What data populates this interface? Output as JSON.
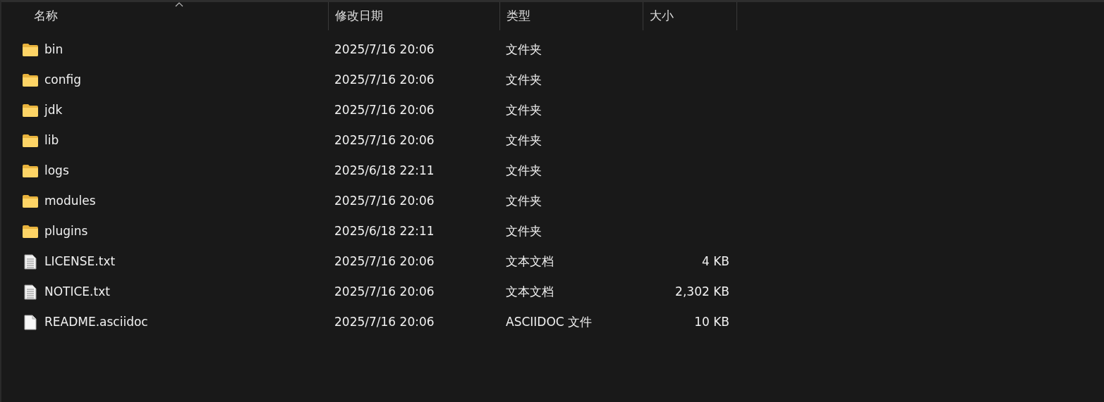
{
  "columns": [
    {
      "label": "名称",
      "sorted": true
    },
    {
      "label": "修改日期",
      "sorted": false
    },
    {
      "label": "类型",
      "sorted": false
    },
    {
      "label": "大小",
      "sorted": false
    }
  ],
  "rows": [
    {
      "kind": "folder",
      "name": "bin",
      "date": "2025/7/16 20:06",
      "type": "文件夹"
    },
    {
      "kind": "folder",
      "name": "config",
      "date": "2025/7/16 20:06",
      "type": "文件夹"
    },
    {
      "kind": "folder",
      "name": "jdk",
      "date": "2025/7/16 20:06",
      "type": "文件夹"
    },
    {
      "kind": "folder",
      "name": "lib",
      "date": "2025/7/16 20:06",
      "type": "文件夹"
    },
    {
      "kind": "folder",
      "name": "logs",
      "date": "2025/6/18 22:11",
      "type": "文件夹"
    },
    {
      "kind": "folder",
      "name": "modules",
      "date": "2025/7/16 20:06",
      "type": "文件夹"
    },
    {
      "kind": "folder",
      "name": "plugins",
      "date": "2025/6/18 22:11",
      "type": "文件夹"
    },
    {
      "kind": "text",
      "name": "LICENSE.txt",
      "date": "2025/7/16 20:06",
      "type": "文本文档",
      "size": "4 KB"
    },
    {
      "kind": "text",
      "name": "NOTICE.txt",
      "date": "2025/7/16 20:06",
      "type": "文本文档",
      "size": "2,302 KB"
    },
    {
      "kind": "file",
      "name": "README.asciidoc",
      "date": "2025/7/16 20:06",
      "type": "ASCIIDOC 文件",
      "size": "10 KB"
    }
  ]
}
